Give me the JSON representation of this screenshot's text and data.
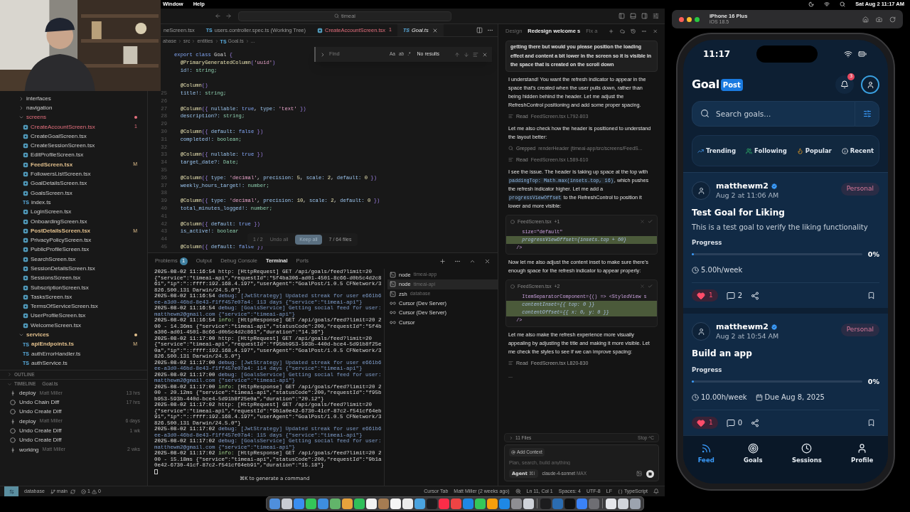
{
  "menubar": {
    "menus": [
      "Window",
      "Help"
    ],
    "clock": "Sat Aug 2  11:17 AM"
  },
  "title_bar": {
    "search": "timeai"
  },
  "sidebar": {
    "tree": [
      {
        "name": "interfaces",
        "kind": "folder",
        "expanded": false,
        "error": false,
        "modified": false
      },
      {
        "name": "navigation",
        "kind": "folder",
        "expanded": false,
        "error": false,
        "modified": false
      },
      {
        "name": "screens",
        "kind": "folder",
        "expanded": true,
        "error": true,
        "modified": false,
        "children": [
          {
            "name": "CreateAccountScreen.tsx",
            "kind": "tsx",
            "error": true,
            "modified": false,
            "badge": "1"
          },
          {
            "name": "CreateGoalScreen.tsx",
            "kind": "tsx",
            "error": false,
            "modified": false
          },
          {
            "name": "CreateSessionScreen.tsx",
            "kind": "tsx",
            "error": false,
            "modified": false
          },
          {
            "name": "EditProfileScreen.tsx",
            "kind": "tsx",
            "error": false,
            "modified": false
          },
          {
            "name": "FeedScreen.tsx",
            "kind": "tsx",
            "error": false,
            "modified": true,
            "badge": "M"
          },
          {
            "name": "FollowersListScreen.tsx",
            "kind": "tsx",
            "error": false,
            "modified": false
          },
          {
            "name": "GoalDetailsScreen.tsx",
            "kind": "tsx",
            "error": false,
            "modified": false
          },
          {
            "name": "GoalsScreen.tsx",
            "kind": "tsx",
            "error": false,
            "modified": false
          },
          {
            "name": "index.ts",
            "kind": "ts",
            "icon_label": "TS",
            "error": false,
            "modified": false
          },
          {
            "name": "LoginScreen.tsx",
            "kind": "tsx",
            "error": false,
            "modified": false
          },
          {
            "name": "OnboardingScreen.tsx",
            "kind": "tsx",
            "error": false,
            "modified": false
          },
          {
            "name": "PostDetailsScreen.tsx",
            "kind": "tsx",
            "error": false,
            "modified": true,
            "badge": "M"
          },
          {
            "name": "PrivacyPolicyScreen.tsx",
            "kind": "tsx",
            "error": false,
            "modified": false
          },
          {
            "name": "PublicProfileScreen.tsx",
            "kind": "tsx",
            "error": false,
            "modified": false
          },
          {
            "name": "SearchScreen.tsx",
            "kind": "tsx",
            "error": false,
            "modified": false
          },
          {
            "name": "SessionDetailsScreen.tsx",
            "kind": "tsx",
            "error": false,
            "modified": false
          },
          {
            "name": "SessionsScreen.tsx",
            "kind": "tsx",
            "error": false,
            "modified": false
          },
          {
            "name": "SubscriptionScreen.tsx",
            "kind": "tsx",
            "error": false,
            "modified": false
          },
          {
            "name": "TasksScreen.tsx",
            "kind": "tsx",
            "error": false,
            "modified": false
          },
          {
            "name": "TermsOfServiceScreen.tsx",
            "kind": "tsx",
            "error": false,
            "modified": false
          },
          {
            "name": "UserProfileScreen.tsx",
            "kind": "tsx",
            "error": false,
            "modified": false
          },
          {
            "name": "WelcomeScreen.tsx",
            "kind": "tsx",
            "error": false,
            "modified": false
          }
        ]
      },
      {
        "name": "services",
        "kind": "folder",
        "expanded": true,
        "error": false,
        "modified": true,
        "children": [
          {
            "name": "apiEndpoints.ts",
            "kind": "ts",
            "icon_label": "TS",
            "error": false,
            "modified": true,
            "badge": "M"
          },
          {
            "name": "authErrorHandler.ts",
            "kind": "ts",
            "icon_label": "TS",
            "error": false,
            "modified": false
          },
          {
            "name": "authService.ts",
            "kind": "ts",
            "icon_label": "TS",
            "error": false,
            "modified": false
          }
        ]
      }
    ],
    "outline": {
      "label": "OUTLINE",
      "expanded": false
    },
    "timeline": {
      "label": "TIMELINE",
      "file": "Goal.ts",
      "expanded": true,
      "items": [
        {
          "kind": "commit",
          "label": "deploy",
          "author": "Matt Miller",
          "age": "13 hrs"
        },
        {
          "kind": "local",
          "label": "Undo Chain Diff",
          "age": "17 hrs"
        },
        {
          "kind": "local",
          "label": "Undo Create Diff"
        },
        {
          "kind": "commit",
          "label": "deploy",
          "author": "Matt Miller",
          "age": "6 days"
        },
        {
          "kind": "local",
          "label": "Undo Create Diff",
          "age": "1 wk"
        },
        {
          "kind": "local",
          "label": "Undo Create Diff"
        },
        {
          "kind": "commit",
          "label": "working",
          "author": "Matt Miller",
          "age": "2 wks"
        }
      ]
    }
  },
  "editor": {
    "tabs": [
      {
        "label": "neScreen.tsx",
        "kind": "plain",
        "error": false,
        "selected": false
      },
      {
        "label": "users.controller.spec.ts (Working Tree)",
        "kind": "ts",
        "icon_label": "TS",
        "error": false,
        "selected": false
      },
      {
        "label": "CreateAccountScreen.tsx",
        "kind": "tsx",
        "error": true,
        "badge": "1",
        "selected": false
      },
      {
        "label": "Goal.ts",
        "kind": "ts",
        "icon_label": "TS",
        "error": false,
        "selected": true
      }
    ],
    "breadcrumb": [
      {
        "label": "abase"
      },
      {
        "label": "src"
      },
      {
        "label": "entities"
      },
      {
        "label": "Goal.ts",
        "icon_label": "TS"
      },
      {
        "label": "..."
      }
    ],
    "code": [
      {
        "text": "export class Goal {"
      },
      {
        "text": "  @PrimaryGeneratedColumn('uuid')"
      },
      {
        "text": "  id!: string;"
      },
      {
        "text": "  @Column()",
        "gap_before": true
      },
      {
        "number": "25",
        "text": "  title!: string;"
      },
      {
        "number": "26"
      },
      {
        "number": "27",
        "text": "  @Column({ nullable: true, type: 'text' })"
      },
      {
        "number": "28",
        "text": "  description?: string;"
      },
      {
        "number": "29"
      },
      {
        "number": "30",
        "text": "  @Column({ default: false })"
      },
      {
        "number": "31",
        "text": "  completed!: boolean;"
      },
      {
        "number": "32"
      },
      {
        "number": "33",
        "text": "  @Column({ nullable: true })"
      },
      {
        "number": "34",
        "text": "  target_date?: Date;"
      },
      {
        "number": "35"
      },
      {
        "number": "36",
        "text": "  @Column({ type: 'decimal', precision: 5, scale: 2, default: 0 })"
      },
      {
        "number": "37",
        "text": "  weekly_hours_target!: number;"
      },
      {
        "number": "38"
      },
      {
        "number": "39",
        "text": "  @Column({ type: 'decimal', precision: 10, scale: 2, default: 0 })"
      },
      {
        "number": "40",
        "text": "  total_minutes_logged!: number;"
      },
      {
        "number": "41"
      },
      {
        "number": "42",
        "text": "  @Column({ default: true })"
      },
      {
        "number": "43",
        "text": "  is_active!: boolear"
      },
      {
        "number": "44"
      },
      {
        "number": "45",
        "text": "  @Column({ default: false })"
      }
    ],
    "find": {
      "placeholder": "Find",
      "options": [
        "Aa",
        "ab",
        ".*"
      ],
      "result": "No results"
    },
    "diff_bar": {
      "counter": "1 / 2",
      "undo": "Undo all",
      "keep": "Keep all",
      "files": "7 / 64 files"
    }
  },
  "panel": {
    "tabs": [
      {
        "label": "Problems",
        "badge": "1",
        "selected": false
      },
      {
        "label": "Output",
        "selected": false
      },
      {
        "label": "Debug Console",
        "selected": false
      },
      {
        "label": "Terminal",
        "selected": true
      },
      {
        "label": "Ports",
        "selected": false
      }
    ],
    "terminal": [
      {
        "time": "2025-08-02 11:16:54",
        "level": "http:",
        "kind": "http",
        "text": "[HttpRequest] GET /api/goals/feed?limit=20 {\"service\":\"timeai-api\",\"requestId\":\"5f4ba306-ad01-4501-8c66-d0b5c4d2c861\",\"ip\":\"::ffff:192.168.4.197\",\"userAgent\":\"GoalPost/1.0.5 CFNetwork/3826.500.131 Darwin/24.5.0\"}"
      },
      {
        "time": "2025-08-02 11:16:54",
        "level": "debug:",
        "kind": "debug",
        "text": "[JwtStrategy] Updated streak for user e661b6ee-a3d0-46bd-8e43-f1ff457e07a4: 113 days {\"service\":\"timeai-api\"}"
      },
      {
        "time": "2025-08-02 11:16:54",
        "level": "debug:",
        "kind": "debug",
        "text": "[GoalsService] Getting social feed for user: matthewm2@gmail.com {\"service\":\"timeai-api\"}"
      },
      {
        "time": "2025-08-02 11:16:54",
        "level": "info:",
        "kind": "info",
        "text": "[HttpResponse] GET /api/goals/feed?limit=20 200 - 14.36ms {\"service\":\"timeai-api\",\"statusCode\":200,\"requestId\":\"5f4ba306-ad01-4501-8c66-d0b5c4d2c861\",\"duration\":\"14.36\"}"
      },
      {
        "time": "2025-08-02 11:17:00",
        "level": "http:",
        "kind": "http",
        "text": "[HttpRequest] GET /api/goals/feed?limit=20 {\"service\":\"timeai-api\",\"requestId\":\"f95bb953-593b-440d-bce4-5d91b8f25e0a\",\"ip\":\"::ffff:192.168.4.197\",\"userAgent\":\"GoalPost/1.0.5 CFNetwork/3826.500.131 Darwin/24.5.0\"}"
      },
      {
        "time": "2025-08-02 11:17:00",
        "level": "debug:",
        "kind": "debug",
        "text": "[JwtStrategy] Updated streak for user e661b6ee-a3d0-46bd-8e43-f1ff457e07a4: 114 days {\"service\":\"timeai-api\"}"
      },
      {
        "time": "2025-08-02 11:17:00",
        "level": "debug:",
        "kind": "debug",
        "text": "[GoalsService] Getting social feed for user: matthewm2@gmail.com {\"service\":\"timeai-api\"}"
      },
      {
        "time": "2025-08-02 11:17:00",
        "level": "info:",
        "kind": "info",
        "text": "[HttpResponse] GET /api/goals/feed?limit=20 200 - 20.12ms {\"service\":\"timeai-api\",\"statusCode\":200,\"requestId\":\"f95bb953-593b-440d-bce4-5d91b8f25e0a\",\"duration\":\"20.12\"}"
      },
      {
        "time": "2025-08-02 11:17:02",
        "level": "http:",
        "kind": "http",
        "text": "[HttpRequest] GET /api/goals/feed?limit=20 {\"service\":\"timeai-api\",\"requestId\":\"9b1a0e42-6730-41cf-87c2-f541cf64eb91\",\"ip\":\"::ffff:192.168.4.197\",\"userAgent\":\"GoalPost/1.0.5 CFNetwork/3826.500.131 Darwin/24.5.0\"}"
      },
      {
        "time": "2025-08-02 11:17:02",
        "level": "debug:",
        "kind": "debug",
        "text": "[JwtStrategy] Updated streak for user e661b6ee-a3d0-46bd-8e43-f1ff457e07a4: 115 days {\"service\":\"timeai-api\"}"
      },
      {
        "time": "2025-08-02 11:17:02",
        "level": "debug:",
        "kind": "debug",
        "text": "[GoalsService] Getting social feed for user: matthewm2@gmail.com {\"service\":\"timeai-api\"}"
      },
      {
        "time": "2025-08-02 11:17:02",
        "level": "info:",
        "kind": "info",
        "text": "[HttpResponse] GET /api/goals/feed?limit=20 200 - 15.18ms {\"service\":\"timeai-api\",\"statusCode\":200,\"requestId\":\"9b1a0e42-6730-41cf-87c2-f541cf64eb91\",\"duration\":\"15.18\"}"
      }
    ],
    "hint": "⌘K to generate a command",
    "terminals": [
      {
        "name": "node",
        "detail": "timeai-app",
        "kind": "shell",
        "selected": false
      },
      {
        "name": "node",
        "detail": "timeai-api",
        "kind": "shell",
        "selected": true
      },
      {
        "name": "zsh",
        "detail": "database",
        "kind": "shell",
        "selected": false
      },
      {
        "name": "Cursor (Dev Server)",
        "kind": "cursor",
        "selected": false
      },
      {
        "name": "Cursor (Dev Server)",
        "kind": "cursor",
        "selected": false
      },
      {
        "name": "Cursor",
        "kind": "cursor",
        "selected": false
      }
    ]
  },
  "chat": {
    "tabs": [
      {
        "label": "Design",
        "selected": false
      },
      {
        "label": "Redesign welcome s",
        "selected": true
      },
      {
        "label": "Fix a",
        "selected": false
      }
    ],
    "blocks": [
      {
        "kind": "user",
        "text": "getting there but would you please position the loading effect and content a bit lower in the screen so it is visible in the space that is created on the scroll down"
      },
      {
        "kind": "text",
        "parts": [
          {
            "kind": "text",
            "text": "I understand! You want the refresh indicator to appear in the space that's created when the user pulls down, rather than being hidden behind the header. Let me adjust the RefreshControl positioning and add some proper spacing."
          }
        ]
      },
      {
        "kind": "tool",
        "action": "Read",
        "detail": "FeedScreen.tsx L792-803",
        "pending": false
      },
      {
        "kind": "text",
        "parts": [
          {
            "kind": "text",
            "text": "Let me also check how the header is positioned to understand the layout better:"
          }
        ]
      },
      {
        "kind": "tool",
        "action": "Grepped",
        "detail": "renderHeader (timeai-app/src/screens/FeedS...",
        "pending": false
      },
      {
        "kind": "tool",
        "action": "Read",
        "detail": "FeedScreen.tsx L589-610",
        "pending": false
      },
      {
        "kind": "text",
        "parts": [
          {
            "kind": "text",
            "text": "I see the issue. The header is taking up space at the top with "
          },
          {
            "kind": "code",
            "text": "paddingTop: Math.max(insets.top, 16)"
          },
          {
            "kind": "text",
            "text": ", which pushes the refresh indicator higher. Let me add a "
          },
          {
            "kind": "code",
            "text": "progressViewOffset"
          },
          {
            "kind": "text",
            "text": " to the RefreshControl to position it lower and more visible:"
          }
        ]
      },
      {
        "kind": "code",
        "file": "FeedScreen.tsx",
        "change": "+1",
        "lines": [
          {
            "text": "    size=\"default\"",
            "added": false
          },
          {
            "text": "    progressViewOffset={insets.top + 60}",
            "added": true
          },
          {
            "text": "  />",
            "added": false
          }
        ]
      },
      {
        "kind": "text",
        "parts": [
          {
            "kind": "text",
            "text": "Now let me also adjust the content inset to make sure there's enough space for the refresh indicator to appear properly:"
          }
        ]
      },
      {
        "kind": "code",
        "file": "FeedScreen.tsx",
        "change": "+2",
        "lines": [
          {
            "text": "    ItemSeparatorComponent={() => <StyledView s",
            "added": false
          },
          {
            "text": "    contentInset={{ top: 0 }}",
            "added": true
          },
          {
            "text": "    contentOffset={{ x: 0, y: 0 }}",
            "added": true
          },
          {
            "text": "  />",
            "added": false
          }
        ]
      },
      {
        "kind": "text",
        "parts": [
          {
            "kind": "text",
            "text": "Let me also make the refresh experience more visually appealing by adjusting the title and making it more visible. Let me check the styles to see if we can improve spacing:"
          }
        ]
      },
      {
        "kind": "tool",
        "action": "Read",
        "detail": "FeedScreen.tsx L820-830",
        "pending": true
      },
      {
        "kind": "ellipsis",
        "text": "..."
      }
    ],
    "files": "11 Files",
    "stop": "Stop",
    "stop_key": "^C",
    "add_context": "Add Context",
    "placeholder": "Plan, search, build anything",
    "mode": "Agent",
    "mode_key": "⌘I",
    "model": "claude-4-sonnet",
    "model_tag": "MAX"
  },
  "status_bar": {
    "folder": "database",
    "branch": "main",
    "errors": "1",
    "warnings": "0",
    "right": [
      "Cursor Tab",
      "Matt Miller (2 weeks ago)"
    ],
    "position": "Ln 11, Col 1",
    "spaces": "Spaces: 4",
    "encoding": "UTF-8",
    "eol": "LF",
    "language": "TypeScript"
  },
  "dock": {
    "groups": [
      [
        {
          "color": "#4f8fdc"
        },
        {
          "color": "#c9ccd3"
        },
        {
          "color": "#3a8ef0"
        },
        {
          "color": "#34c759"
        },
        {
          "color": "#3e8ede"
        },
        {
          "color": "#62b46a"
        },
        {
          "color": "#e8a33c"
        },
        {
          "color": "#2fbf5a"
        },
        {
          "color": "#f2f2f2"
        },
        {
          "color": "#a67c52"
        },
        {
          "color": "#f5f5f5"
        },
        {
          "color": "#ececec"
        },
        {
          "color": "#4aa3df"
        },
        {
          "color": "#1c1c1e"
        },
        {
          "color": "#fa2d48"
        },
        {
          "color": "#ef4444"
        },
        {
          "color": "#1e88e5"
        },
        {
          "color": "#34c759"
        },
        {
          "color": "#f59e0b"
        },
        {
          "color": "#1e88e5"
        },
        {
          "color": "#8e8e93"
        },
        {
          "color": "#cfd3da"
        }
      ],
      [
        {
          "color": "#1c1c1e"
        },
        {
          "color": "#2b6cb0"
        },
        {
          "color": "#111111"
        },
        {
          "color": "#3b82f6"
        },
        {
          "color": "#6e6e73"
        }
      ],
      [
        {
          "color": "#e5e7eb"
        },
        {
          "color": "#d1d5db"
        },
        {
          "color": "#9ca3af"
        }
      ]
    ]
  },
  "simulator": {
    "device": "iPhone 16 Plus",
    "os": "iOS 18.5"
  },
  "phone": {
    "time": "11:17",
    "logo": [
      "Goal",
      "Post"
    ],
    "notifications": "3",
    "search": {
      "placeholder": "Search goals..."
    },
    "filters": [
      {
        "label": "Trending",
        "kind": "trending"
      },
      {
        "label": "Following",
        "kind": "following"
      },
      {
        "label": "Popular",
        "kind": "popular"
      },
      {
        "label": "Recent",
        "kind": "recent"
      }
    ],
    "posts": [
      {
        "user": "matthewm2",
        "verified": true,
        "time": "Aug 2 at 11:06 AM",
        "tag": "Personal",
        "title": "Test Goal for Liking",
        "description": "This is a test goal to verify the liking functionality",
        "progress_label": "Progress",
        "level": 0,
        "percent": "0%",
        "weekly": "5.00h/week",
        "liked": true,
        "likes": "1",
        "comments": "2"
      },
      {
        "user": "matthewm2",
        "verified": true,
        "time": "Aug 2 at 10:54 AM",
        "tag": "Personal",
        "title": "Build an app",
        "progress_label": "Progress",
        "level": 0,
        "percent": "0%",
        "weekly": "10.00h/week",
        "due": "Due Aug 8, 2025",
        "liked": true,
        "likes": "1",
        "comments": "0"
      }
    ],
    "nav": [
      {
        "label": "Feed",
        "kind": "feed",
        "selected": true
      },
      {
        "label": "Goals",
        "kind": "goals",
        "selected": false
      },
      {
        "label": "Sessions",
        "kind": "sessions",
        "selected": false
      },
      {
        "label": "Profile",
        "kind": "profile",
        "selected": false
      }
    ]
  }
}
